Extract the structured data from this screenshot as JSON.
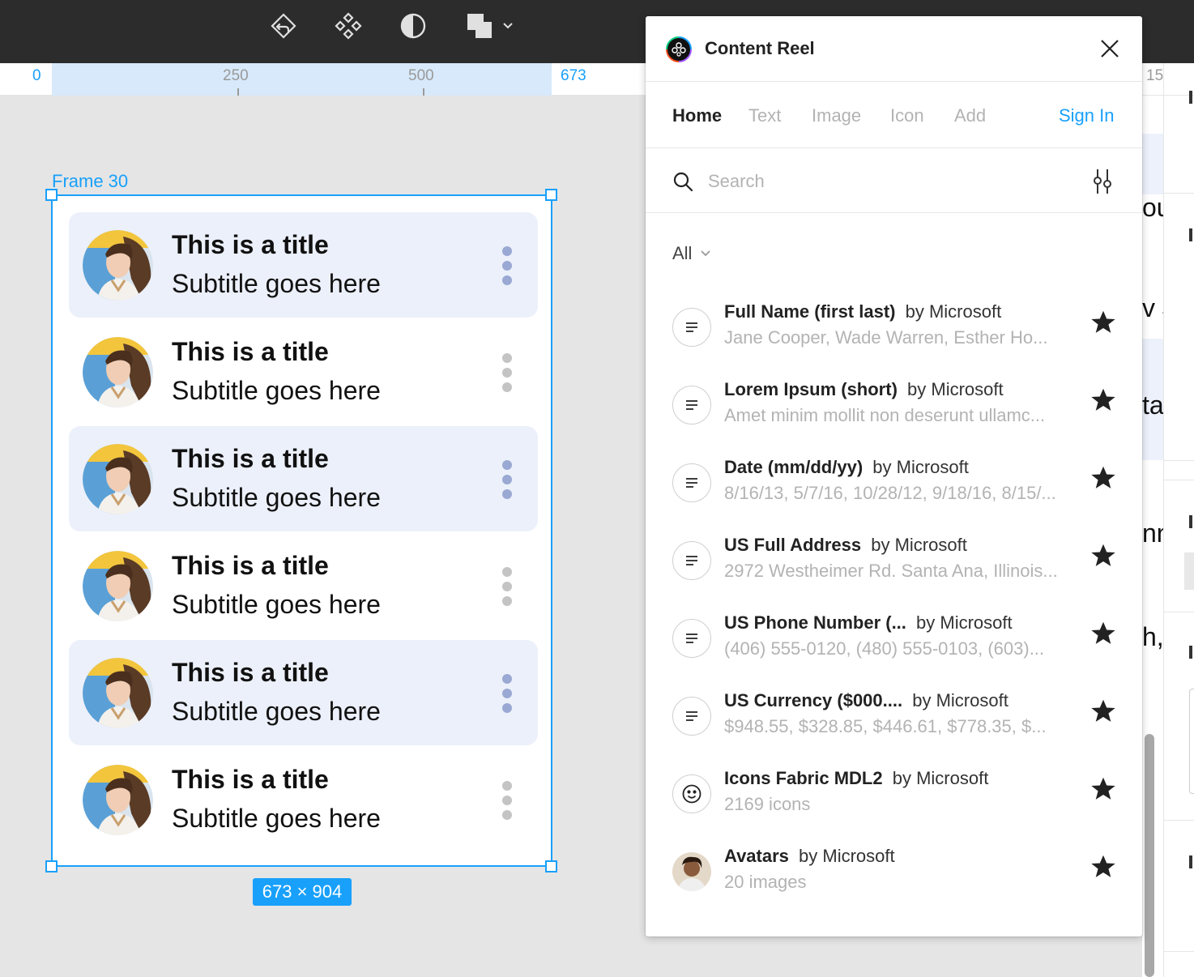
{
  "toolbar": {
    "icons": [
      "undo-icon",
      "component-icon",
      "contrast-icon",
      "boolean-group-icon",
      "chevron-down-icon"
    ]
  },
  "ruler": {
    "labels": [
      "0",
      "250",
      "500",
      "673",
      "15"
    ]
  },
  "frame": {
    "name": "Frame 30",
    "size_label": "673 × 904",
    "cards": [
      {
        "title": "This is a title",
        "subtitle": "Subtitle goes here",
        "highlighted": true
      },
      {
        "title": "This is a title",
        "subtitle": "Subtitle goes here",
        "highlighted": false
      },
      {
        "title": "This is a title",
        "subtitle": "Subtitle goes here",
        "highlighted": true
      },
      {
        "title": "This is a title",
        "subtitle": "Subtitle goes here",
        "highlighted": false
      },
      {
        "title": "This is a title",
        "subtitle": "Subtitle goes here",
        "highlighted": true
      },
      {
        "title": "This is a title",
        "subtitle": "Subtitle goes here",
        "highlighted": false
      }
    ]
  },
  "plugin": {
    "title": "Content Reel",
    "nav": {
      "home": "Home",
      "text": "Text",
      "image": "Image",
      "icon": "Icon",
      "add": "Add",
      "sign_in": "Sign In"
    },
    "search": {
      "placeholder": "Search",
      "value": ""
    },
    "filter": {
      "selected": "All"
    },
    "items": [
      {
        "name": "Full Name (first last)",
        "by": "by Microsoft",
        "preview": "Jane Cooper, Wade Warren, Esther Ho...",
        "icon": "text-lines-icon"
      },
      {
        "name": "Lorem Ipsum (short)",
        "by": "by Microsoft",
        "preview": "Amet minim mollit non deserunt ullamc...",
        "icon": "text-lines-icon"
      },
      {
        "name": "Date (mm/dd/yy)",
        "by": "by Microsoft",
        "preview": "8/16/13, 5/7/16, 10/28/12, 9/18/16, 8/15/...",
        "icon": "text-lines-icon"
      },
      {
        "name": "US Full Address",
        "by": "by Microsoft",
        "preview": "2972 Westheimer Rd. Santa Ana, Illinois...",
        "icon": "text-lines-icon"
      },
      {
        "name": "US Phone Number (...",
        "by": "by Microsoft",
        "preview": "(406) 555-0120, (480) 555-0103, (603)...",
        "icon": "text-lines-icon"
      },
      {
        "name": "US Currency ($000....",
        "by": "by Microsoft",
        "preview": "$948.55, $328.85, $446.61, $778.35, $...",
        "icon": "text-lines-icon"
      },
      {
        "name": "Icons Fabric MDL2",
        "by": "by Microsoft",
        "preview": "2169 icons",
        "icon": "smiley-icon"
      },
      {
        "name": "Avatars",
        "by": "by Microsoft",
        "preview": "20 images",
        "icon": "avatar-photo"
      }
    ]
  },
  "right_panel": {
    "fragments": [
      "ou",
      "v J",
      "ta",
      "nn",
      "h,"
    ]
  },
  "colors": {
    "selection_blue": "#18a0fb",
    "card_highlight": "#ecf0fa",
    "kebab_blue": "#9aa9d3",
    "kebab_gray": "#c4c4c4",
    "toolbar_bg": "#2c2c2c",
    "canvas_bg": "#e5e5e5"
  }
}
